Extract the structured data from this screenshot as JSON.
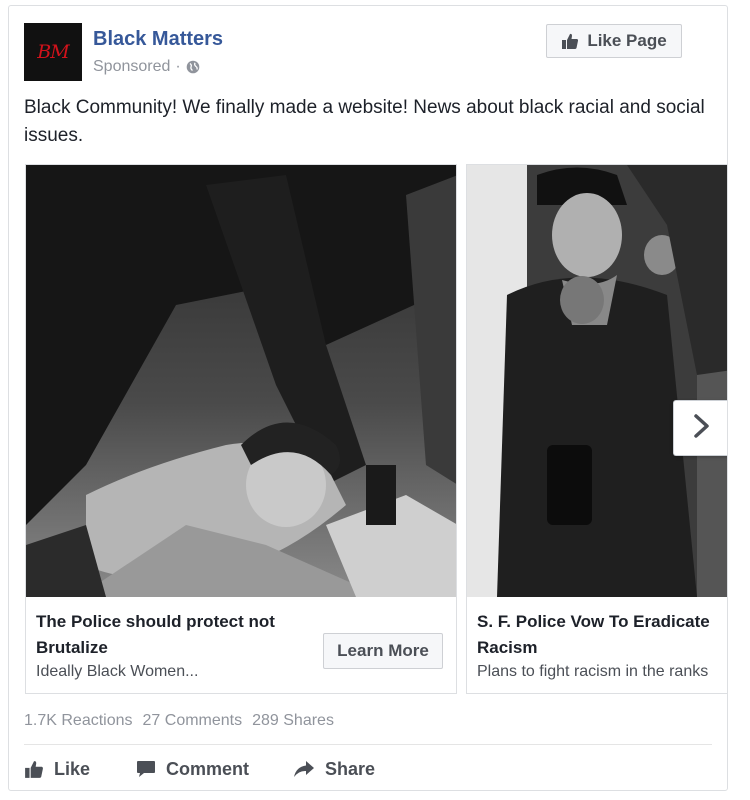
{
  "header": {
    "avatar_text": "BM",
    "page_name": "Black Matters",
    "sponsored_label": "Sponsored",
    "separator": "·",
    "privacy_icon": "globe-icon",
    "like_page_label": "Like Page"
  },
  "post": {
    "text": "Black Community! We finally made a website! News about black racial and social issues."
  },
  "carousel": {
    "cards": [
      {
        "title": "The Police should protect not Brutalize",
        "description": "Ideally Black Women...",
        "cta_label": "Learn More"
      },
      {
        "title": "S. F. Police Vow To Eradicate Racism",
        "description": "Plans to fight racism in the ranks"
      }
    ],
    "next_icon": "chevron-right-icon"
  },
  "stats": {
    "reactions": "1.7K Reactions",
    "comments": "27 Comments",
    "shares": "289 Shares"
  },
  "actions": {
    "like": "Like",
    "comment": "Comment",
    "share": "Share"
  },
  "colors": {
    "link_blue": "#365899",
    "meta_gray": "#90949c",
    "button_text": "#4b4f56",
    "logo_red": "#d0121b"
  }
}
